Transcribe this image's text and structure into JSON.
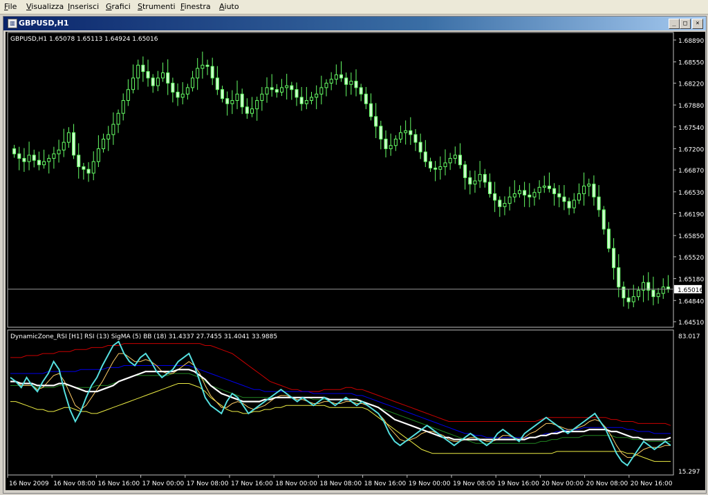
{
  "menubar": {
    "items": [
      {
        "pre": "",
        "u": "F",
        "post": "ile"
      },
      {
        "pre": "",
        "u": "V",
        "post": "isualizza"
      },
      {
        "pre": "",
        "u": "I",
        "post": "nserisci"
      },
      {
        "pre": "",
        "u": "G",
        "post": "rafici"
      },
      {
        "pre": "",
        "u": "S",
        "post": "trumenti"
      },
      {
        "pre": "",
        "u": "F",
        "post": "inestra"
      },
      {
        "pre": "",
        "u": "A",
        "post": "iuto"
      }
    ]
  },
  "window": {
    "title": "GBPUSD,H1",
    "min_glyph": "_",
    "max_glyph": "□",
    "close_glyph": "×"
  },
  "colors": {
    "background": "#000000",
    "grid": "#c0c0c0",
    "candle_up": "#000000",
    "candle_down": "#ccffcc",
    "wick": "#66ff66",
    "rsi": "#55e0e0",
    "bb_upper": "#cc0000",
    "bb_mid": "#0000ee",
    "bb_lower": "#eeee44",
    "signal_ma": "#ffffff",
    "dz_line": "#228822",
    "fast_line": "#ffcc66"
  },
  "chart_data": [
    {
      "type": "candlestick",
      "title": "GBPUSD,H1  1.65078 1.65113 1.64924 1.65016",
      "symbol": "GBPUSD,H1",
      "ohlc_last": "1.65078 1.65113 1.64924 1.65016",
      "ylim": [
        1.6451,
        1.6889
      ],
      "yticks": [
        "1.68890",
        "1.68550",
        "1.68220",
        "1.67880",
        "1.67540",
        "1.67200",
        "1.66870",
        "1.66530",
        "1.66190",
        "1.65850",
        "1.65520",
        "1.65180",
        "1.64840",
        "1.64510"
      ],
      "yticks_values": [
        1.6889,
        1.6855,
        1.6822,
        1.6788,
        1.6754,
        1.672,
        1.6687,
        1.6653,
        1.6619,
        1.6585,
        1.6552,
        1.6518,
        1.6484,
        1.6451
      ],
      "current_price": 1.65016,
      "current_price_label": "1.65016",
      "closes": [
        1.6712,
        1.6705,
        1.67,
        1.671,
        1.6702,
        1.6695,
        1.67,
        1.6705,
        1.6712,
        1.6718,
        1.673,
        1.6745,
        1.671,
        1.6692,
        1.6688,
        1.6682,
        1.67,
        1.672,
        1.6735,
        1.6742,
        1.6758,
        1.6775,
        1.6795,
        1.6812,
        1.683,
        1.685,
        1.684,
        1.683,
        1.6818,
        1.683,
        1.6838,
        1.6822,
        1.6808,
        1.68,
        1.6805,
        1.6815,
        1.683,
        1.6845,
        1.685,
        1.6848,
        1.683,
        1.6812,
        1.6798,
        1.679,
        1.6795,
        1.6805,
        1.6785,
        1.6775,
        1.6782,
        1.6795,
        1.6805,
        1.6815,
        1.6812,
        1.6808,
        1.6815,
        1.6818,
        1.6812,
        1.68,
        1.679,
        1.6795,
        1.68,
        1.6805,
        1.6815,
        1.6822,
        1.6828,
        1.6835,
        1.683,
        1.682,
        1.6825,
        1.6815,
        1.6805,
        1.679,
        1.677,
        1.6755,
        1.6735,
        1.672,
        1.6725,
        1.6735,
        1.6745,
        1.6748,
        1.6742,
        1.673,
        1.6715,
        1.67,
        1.669,
        1.6688,
        1.6692,
        1.6698,
        1.6705,
        1.671,
        1.6695,
        1.6675,
        1.6665,
        1.667,
        1.668,
        1.6668,
        1.665,
        1.664,
        1.663,
        1.6635,
        1.6645,
        1.665,
        1.6655,
        1.6648,
        1.6645,
        1.6652,
        1.666,
        1.6662,
        1.6658,
        1.665,
        1.6645,
        1.6638,
        1.6628,
        1.664,
        1.665,
        1.6662,
        1.6665,
        1.6645,
        1.6625,
        1.6595,
        1.6565,
        1.6535,
        1.6505,
        1.6488,
        1.6482,
        1.649,
        1.65,
        1.6512,
        1.65,
        1.649,
        1.6495,
        1.6505,
        1.6502
      ],
      "xticks": [
        "16 Nov 2009",
        "16 Nov 08:00",
        "16 Nov 16:00",
        "17 Nov 00:00",
        "17 Nov 08:00",
        "17 Nov 16:00",
        "18 Nov 00:00",
        "18 Nov 08:00",
        "18 Nov 16:00",
        "19 Nov 00:00",
        "19 Nov 08:00",
        "19 Nov 16:00",
        "20 Nov 00:00",
        "20 Nov 08:00",
        "20 Nov 16:00"
      ]
    },
    {
      "type": "line",
      "title": "DynamicZone_RSI [H1] RSI (13) SigMA (5) BB (18)  31.4337 27.7455 31.4041 33.9885",
      "label": "DynamicZone_RSI [H1] RSI (13) SigMA (5) BB (18)",
      "values_text": "31.4337 27.7455 31.4041 33.9885",
      "ylim": [
        15.297,
        83.017
      ],
      "yticks": [
        "83.017",
        "15.297"
      ],
      "yticks_values": [
        83.017,
        15.297
      ],
      "series": [
        {
          "color": "#55e0e0",
          "values": [
            62,
            60,
            57,
            62,
            58,
            55,
            60,
            64,
            70,
            66,
            55,
            46,
            40,
            45,
            52,
            58,
            62,
            68,
            73,
            78,
            80,
            74,
            70,
            68,
            72,
            74,
            70,
            65,
            62,
            64,
            66,
            70,
            72,
            74,
            68,
            60,
            52,
            48,
            46,
            44,
            50,
            54,
            52,
            48,
            44,
            46,
            48,
            50,
            52,
            54,
            56,
            54,
            52,
            50,
            52,
            50,
            48,
            50,
            52,
            50,
            48,
            50,
            52,
            50,
            48,
            50,
            48,
            46,
            44,
            40,
            34,
            30,
            28,
            30,
            32,
            34,
            36,
            38,
            36,
            34,
            32,
            30,
            28,
            30,
            32,
            34,
            32,
            30,
            28,
            30,
            34,
            36,
            34,
            32,
            30,
            34,
            36,
            38,
            40,
            42,
            40,
            38,
            36,
            34,
            36,
            38,
            40,
            42,
            44,
            40,
            36,
            30,
            24,
            20,
            18,
            22,
            26,
            30,
            28,
            26,
            28,
            30,
            28
          ]
        },
        {
          "color": "#cc0000",
          "values": [
            72,
            72,
            72,
            73,
            73,
            73,
            74,
            74,
            74,
            75,
            75,
            75,
            76,
            76,
            76,
            77,
            77,
            77,
            78,
            78,
            78,
            79,
            79,
            79,
            79,
            79,
            79,
            79,
            79,
            79,
            79,
            79,
            79,
            79,
            79,
            79,
            78,
            78,
            77,
            76,
            75,
            74,
            72,
            70,
            68,
            66,
            64,
            62,
            60,
            59,
            58,
            57,
            56,
            56,
            55,
            55,
            55,
            55,
            56,
            56,
            56,
            56,
            57,
            57,
            56,
            56,
            55,
            54,
            53,
            52,
            51,
            50,
            49,
            48,
            47,
            46,
            45,
            44,
            43,
            42,
            41,
            40,
            40,
            40,
            40,
            40,
            40,
            40,
            40,
            40,
            40,
            40,
            40,
            40,
            40,
            40,
            40,
            40,
            41,
            42,
            42,
            42,
            42,
            42,
            42,
            42,
            42,
            42,
            42,
            42,
            42,
            41,
            41,
            40,
            40,
            40,
            39,
            39,
            39,
            39,
            39,
            39,
            38
          ]
        },
        {
          "color": "#0000ee",
          "values": [
            64,
            64,
            64,
            64,
            64,
            64,
            64,
            65,
            65,
            65,
            65,
            65,
            65,
            66,
            66,
            66,
            66,
            66,
            67,
            67,
            67,
            68,
            68,
            68,
            68,
            68,
            68,
            68,
            68,
            68,
            68,
            68,
            68,
            68,
            67,
            66,
            65,
            64,
            63,
            62,
            61,
            60,
            59,
            58,
            57,
            56,
            56,
            55,
            55,
            55,
            55,
            55,
            55,
            55,
            55,
            55,
            54,
            54,
            54,
            54,
            54,
            54,
            54,
            54,
            53,
            53,
            52,
            51,
            50,
            49,
            48,
            47,
            46,
            45,
            44,
            43,
            42,
            41,
            40,
            39,
            38,
            37,
            36,
            35,
            34,
            34,
            33,
            33,
            32,
            32,
            32,
            32,
            32,
            32,
            32,
            32,
            32,
            32,
            33,
            34,
            34,
            35,
            35,
            36,
            36,
            36,
            37,
            37,
            37,
            37,
            37,
            37,
            37,
            37,
            36,
            36,
            35,
            35,
            35,
            34,
            34,
            34,
            34
          ]
        },
        {
          "color": "#228822",
          "values": [
            58,
            58,
            58,
            58,
            58,
            57,
            57,
            57,
            57,
            58,
            58,
            58,
            57,
            57,
            57,
            57,
            58,
            58,
            58,
            59,
            60,
            61,
            62,
            63,
            63,
            63,
            63,
            63,
            63,
            63,
            64,
            64,
            64,
            64,
            63,
            62,
            60,
            58,
            57,
            56,
            55,
            54,
            53,
            52,
            52,
            52,
            52,
            52,
            52,
            52,
            52,
            52,
            52,
            52,
            52,
            52,
            51,
            51,
            51,
            51,
            51,
            51,
            51,
            51,
            50,
            50,
            49,
            48,
            47,
            46,
            45,
            44,
            43,
            42,
            41,
            40,
            39,
            38,
            37,
            36,
            35,
            34,
            33,
            32,
            31,
            30,
            29,
            29,
            29,
            29,
            29,
            29,
            29,
            29,
            29,
            29,
            29,
            29,
            30,
            30,
            31,
            31,
            32,
            32,
            32,
            32,
            33,
            33,
            33,
            33,
            33,
            33,
            32,
            32,
            32,
            31,
            31,
            31,
            30,
            30,
            30,
            30,
            30
          ]
        },
        {
          "color": "#eeee44",
          "values": [
            50,
            50,
            49,
            48,
            47,
            46,
            46,
            45,
            45,
            46,
            47,
            47,
            46,
            45,
            45,
            44,
            44,
            45,
            46,
            47,
            48,
            49,
            50,
            51,
            52,
            53,
            54,
            55,
            56,
            57,
            58,
            59,
            59,
            59,
            58,
            57,
            55,
            52,
            50,
            48,
            46,
            45,
            45,
            44,
            44,
            45,
            45,
            46,
            46,
            47,
            47,
            48,
            48,
            48,
            48,
            48,
            48,
            48,
            48,
            47,
            47,
            47,
            47,
            47,
            47,
            47,
            46,
            44,
            42,
            40,
            38,
            36,
            34,
            32,
            30,
            28,
            26,
            25,
            24,
            24,
            24,
            24,
            24,
            24,
            24,
            24,
            24,
            24,
            24,
            24,
            24,
            24,
            24,
            24,
            24,
            24,
            24,
            24,
            24,
            24,
            24,
            25,
            25,
            25,
            25,
            25,
            25,
            25,
            25,
            25,
            25,
            25,
            25,
            25,
            24,
            24,
            23,
            22,
            21,
            20,
            20,
            20,
            20
          ]
        },
        {
          "color": "#ffffff",
          "values": [
            60,
            60,
            59,
            59,
            59,
            58,
            58,
            58,
            58,
            59,
            59,
            58,
            57,
            56,
            55,
            55,
            55,
            56,
            57,
            58,
            60,
            61,
            62,
            63,
            64,
            65,
            65,
            65,
            65,
            65,
            65,
            66,
            66,
            66,
            65,
            63,
            61,
            58,
            56,
            54,
            53,
            52,
            51,
            50,
            50,
            50,
            50,
            51,
            51,
            52,
            52,
            52,
            52,
            52,
            52,
            52,
            52,
            52,
            52,
            51,
            51,
            51,
            51,
            51,
            51,
            50,
            49,
            48,
            47,
            45,
            43,
            41,
            40,
            39,
            38,
            37,
            36,
            35,
            34,
            33,
            32,
            32,
            31,
            31,
            31,
            31,
            31,
            31,
            31,
            31,
            31,
            31,
            31,
            31,
            31,
            31,
            32,
            32,
            33,
            33,
            34,
            34,
            35,
            35,
            35,
            35,
            35,
            36,
            36,
            36,
            36,
            35,
            35,
            34,
            33,
            32,
            32,
            31,
            31,
            31,
            31,
            31,
            32
          ]
        },
        {
          "color": "#ffcc66",
          "values": [
            60,
            60,
            58,
            58,
            58,
            56,
            57,
            60,
            63,
            64,
            60,
            54,
            48,
            46,
            48,
            52,
            56,
            60,
            65,
            70,
            74,
            74,
            72,
            70,
            70,
            71,
            70,
            68,
            65,
            64,
            64,
            66,
            68,
            70,
            68,
            64,
            58,
            53,
            50,
            47,
            47,
            49,
            50,
            49,
            47,
            46,
            47,
            48,
            50,
            52,
            53,
            53,
            52,
            51,
            51,
            50,
            49,
            49,
            50,
            50,
            49,
            49,
            50,
            50,
            49,
            49,
            48,
            46,
            44,
            41,
            37,
            34,
            31,
            30,
            31,
            32,
            34,
            35,
            35,
            34,
            33,
            31,
            30,
            30,
            31,
            32,
            32,
            31,
            30,
            30,
            31,
            33,
            33,
            32,
            31,
            32,
            34,
            35,
            37,
            39,
            39,
            38,
            37,
            36,
            36,
            37,
            38,
            40,
            41,
            40,
            37,
            33,
            28,
            24,
            22,
            22,
            24,
            26,
            27,
            27,
            27,
            28,
            28
          ]
        }
      ]
    }
  ]
}
